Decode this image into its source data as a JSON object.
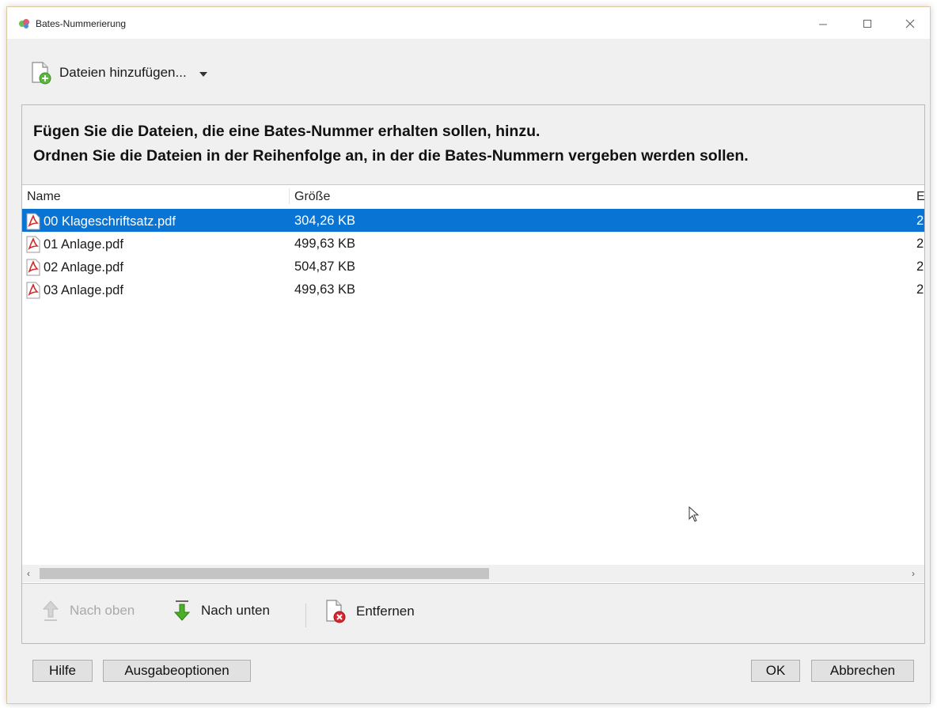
{
  "window": {
    "title": "Bates-Nummerierung",
    "controls": {
      "minimize": "—",
      "maximize": "☐",
      "close": "✕"
    }
  },
  "toolbar": {
    "add_files_label": "Dateien hinzufügen..."
  },
  "instructions": {
    "line1": "Fügen Sie die Dateien, die eine Bates-Nummer erhalten sollen, hinzu.",
    "line2": "Ordnen Sie die Dateien in der Reihenfolge an, in der die Bates-Nummern vergeben werden sollen."
  },
  "list": {
    "columns": {
      "name": "Name",
      "size": "Größe",
      "more": "E"
    },
    "rows": [
      {
        "name": "00 Klageschriftsatz.pdf",
        "size": "304,26 KB",
        "more": "2",
        "selected": true
      },
      {
        "name": "01 Anlage.pdf",
        "size": "499,63 KB",
        "more": "2",
        "selected": false
      },
      {
        "name": "02 Anlage.pdf",
        "size": "504,87 KB",
        "more": "2",
        "selected": false
      },
      {
        "name": "03 Anlage.pdf",
        "size": "499,63 KB",
        "more": "2",
        "selected": false
      }
    ],
    "scroll": {
      "left_arrow": "‹",
      "right_arrow": "›"
    }
  },
  "actions": {
    "move_up": "Nach oben",
    "move_down": "Nach unten",
    "remove": "Entfernen"
  },
  "footer": {
    "help": "Hilfe",
    "output_options": "Ausgabeoptionen",
    "ok": "OK",
    "cancel": "Abbrechen"
  },
  "colors": {
    "selection": "#0a74d4",
    "pdf_red": "#d62828",
    "move_down_green": "#4caf2a",
    "remove_red": "#d9262c"
  }
}
